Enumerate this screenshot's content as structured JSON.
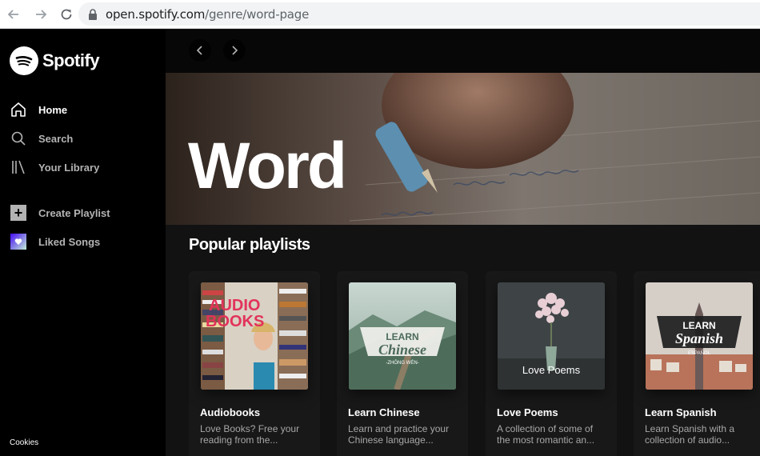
{
  "browser": {
    "url_host": "open.spotify.com",
    "url_path": "/genre/word-page"
  },
  "sidebar": {
    "brand": "Spotify",
    "nav": [
      {
        "label": "Home",
        "icon": "home-icon",
        "active": true
      },
      {
        "label": "Search",
        "icon": "search-icon",
        "active": false
      },
      {
        "label": "Your Library",
        "icon": "library-icon",
        "active": false
      }
    ],
    "create_playlist": "Create Playlist",
    "liked_songs": "Liked Songs",
    "cookies": "Cookies"
  },
  "hero": {
    "title": "Word"
  },
  "section": {
    "title": "Popular playlists"
  },
  "playlists": [
    {
      "title": "Audiobooks",
      "desc": "Love Books? Free your reading from the...",
      "art_text_1": "AUDIO",
      "art_text_2": "BOOKS"
    },
    {
      "title": "Learn Chinese",
      "desc": "Learn and practice your Chinese language...",
      "art_text_1": "LEARN",
      "art_text_2": "Chinese",
      "art_text_3": "-ZHŌNG WÉN-"
    },
    {
      "title": "Love Poems",
      "desc": "A collection of some of the most romantic an...",
      "art_text_1": "Love Poems"
    },
    {
      "title": "Learn Spanish",
      "desc": "Learn Spanish with a collection of audio...",
      "art_text_1": "LEARN",
      "art_text_2": "Spanish",
      "art_text_3": "ESPAÑOL"
    }
  ],
  "colors": {
    "accent": "#1db954",
    "sidebar_bg": "#000000",
    "main_bg": "#121212",
    "card_bg": "#181818"
  }
}
